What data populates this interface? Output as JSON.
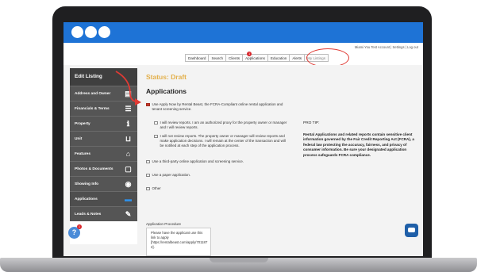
{
  "browser": {
    "title_bar_color": "#1e73d6",
    "window_controls": [
      "close-dot",
      "minimize-dot",
      "zoom-dot"
    ]
  },
  "utility_links": "Miami You Test Account | Settings | Log out",
  "nav": {
    "tabs": [
      {
        "label": "Dashboard",
        "highlight": false,
        "badge": ""
      },
      {
        "label": "Search",
        "highlight": false,
        "badge": ""
      },
      {
        "label": "Clients",
        "highlight": false,
        "badge": ""
      },
      {
        "label": "Applications",
        "highlight": false,
        "badge": "1"
      },
      {
        "label": "Education",
        "highlight": false,
        "badge": ""
      },
      {
        "label": "Alerts",
        "highlight": false,
        "badge": ""
      },
      {
        "label": "My Listings",
        "highlight": true,
        "badge": ""
      }
    ]
  },
  "sidebar": {
    "header": "Edit Listing",
    "items": [
      {
        "label": "Address and Owner",
        "icon": "id-card-icon",
        "glyph": "▤",
        "active": false
      },
      {
        "label": "Financials & Terms",
        "icon": "money-icon",
        "glyph": "☰",
        "active": false
      },
      {
        "label": "Property",
        "icon": "info-icon",
        "glyph": "ℹ",
        "active": false
      },
      {
        "label": "Unit",
        "icon": "bathtub-icon",
        "glyph": "⊔",
        "active": false
      },
      {
        "label": "Features",
        "icon": "home-icon",
        "glyph": "⌂",
        "active": false
      },
      {
        "label": "Photos & Documents",
        "icon": "document-icon",
        "glyph": "▢",
        "active": false
      },
      {
        "label": "Showing Info",
        "icon": "eye-icon",
        "glyph": "◉",
        "active": false
      },
      {
        "label": "Applications",
        "icon": "folder-icon",
        "glyph": "▬",
        "active": true
      },
      {
        "label": "Leads & Notes",
        "icon": "wrench-icon",
        "glyph": "✎",
        "active": false
      }
    ]
  },
  "help": {
    "label": "?",
    "badge": "1"
  },
  "main": {
    "status": "Status: Draft",
    "heading": "Applications",
    "options": {
      "apply_now": {
        "checked": true,
        "text": "Use Apply Now by Rental Beast, the FCRA-Compliant online rental application and tenant screening service."
      },
      "review_reports": {
        "checked": false,
        "text": "I will review reports. I am an authorized proxy for the property owner or manager and I will review reports."
      },
      "no_review": {
        "checked": false,
        "text": "I will not review reports. The property owner or manager will review reports and make application decisions. I will remain at the center of the transaction and will be notified at each step of the application process."
      },
      "third_party": {
        "checked": false,
        "text": "Use a third-party online application and screening service."
      },
      "paper": {
        "checked": false,
        "text": "Use a paper application."
      },
      "other": {
        "checked": false,
        "text": "Other"
      }
    },
    "procedure_label": "Application Procedure",
    "procedure_text": "Please have the applicant use this link to apply [https://rentalbeast.com/apply/701187 2]."
  },
  "tip": {
    "title": "PRO TIP:",
    "body": "Rental Applications and related reports contain sensitive client information governed by the Fair Credit Reporting Act (FCRA), a federal law protecting the accuracy, fairness, and privacy of consumer information. Be sure your designated application process safeguards FCRA compliance."
  },
  "colors": {
    "status": "#e3b04b",
    "sidebar_dark": "#555555",
    "annotation_red": "#e03a34",
    "chat": "#1f5fa8"
  }
}
